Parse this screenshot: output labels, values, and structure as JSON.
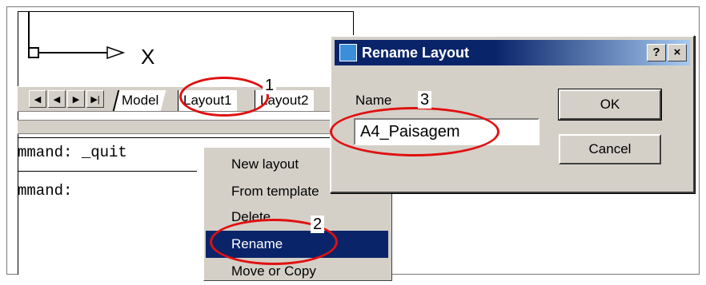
{
  "tabbar": {
    "model": "Model",
    "layout1": "Layout1",
    "layout2": "Layout2"
  },
  "drawing": {
    "axis_label": "X"
  },
  "command_line": {
    "line1": "mmand:  _quit",
    "line2": "mmand:"
  },
  "context_menu": {
    "items": [
      "New layout",
      "From template",
      "Delete",
      "Rename",
      "Move or Copy"
    ],
    "selected": "Rename"
  },
  "dialog": {
    "title": "Rename Layout",
    "help_label": "?",
    "close_label": "×",
    "name_label": "Name",
    "name_value": "A4_Paisagem",
    "ok_label": "OK",
    "cancel_label": "Cancel"
  },
  "annotations": [
    "1",
    "2",
    "3"
  ],
  "colors": {
    "highlight": "#0a246a",
    "annotation": "#e01010",
    "chrome": "#d4d0c8"
  }
}
